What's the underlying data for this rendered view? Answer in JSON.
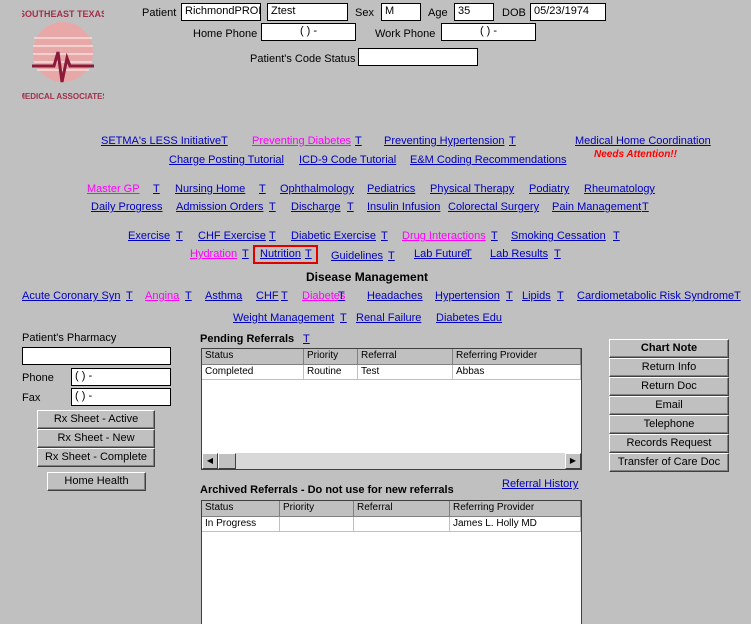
{
  "logo": {
    "text": "SOUTHEAST TEXAS SETMA MEDICAL ASSOCIATES, L.L.P."
  },
  "patient": {
    "label": "Patient",
    "last": "RichmondPROD",
    "first": "Ztest",
    "sex_label": "Sex",
    "sex": "M",
    "age_label": "Age",
    "age": "35",
    "dob_label": "DOB",
    "dob": "05/23/1974",
    "home_phone_label": "Home Phone",
    "home_phone": "(   )   -",
    "work_phone_label": "Work Phone",
    "work_phone": "(   )   -",
    "code_status_label": "Patient's Code Status",
    "code_status": ""
  },
  "links": [
    {
      "label": "SETMA's LESS Initiative",
      "pink": false
    },
    {
      "label": "T"
    },
    {
      "label": "Preventing Diabetes",
      "pink": true
    },
    {
      "label": "T"
    },
    {
      "label": "Preventing Hypertension",
      "pink": false
    },
    {
      "label": "T"
    },
    {
      "label": "Medical Home Coordination",
      "pink": false
    },
    {
      "label": "Charge Posting Tutorial"
    },
    {
      "label": "ICD-9 Code Tutorial"
    },
    {
      "label": "E&M Coding Recommendations"
    },
    {
      "label": "Master GP",
      "pink": true
    },
    {
      "label": "T"
    },
    {
      "label": "Nursing Home"
    },
    {
      "label": "T"
    },
    {
      "label": "Ophthalmology"
    },
    {
      "label": "Pediatrics"
    },
    {
      "label": "Physical Therapy"
    },
    {
      "label": "Podiatry"
    },
    {
      "label": "Rheumatology"
    },
    {
      "label": "Daily Progress"
    },
    {
      "label": "Admission Orders"
    },
    {
      "label": "T"
    },
    {
      "label": "Discharge"
    },
    {
      "label": "T"
    },
    {
      "label": "Insulin Infusion"
    },
    {
      "label": "Colorectal Surgery"
    },
    {
      "label": "Pain Management"
    },
    {
      "label": "T"
    },
    {
      "label": "Exercise"
    },
    {
      "label": "T"
    },
    {
      "label": "CHF Exercise"
    },
    {
      "label": "T"
    },
    {
      "label": "Diabetic Exercise"
    },
    {
      "label": "T"
    },
    {
      "label": "Drug Interactions",
      "pink": true
    },
    {
      "label": "T"
    },
    {
      "label": "Smoking Cessation"
    },
    {
      "label": "T"
    },
    {
      "label": "Hydration",
      "pink": true
    },
    {
      "label": "T"
    },
    {
      "label": "Nutrition"
    },
    {
      "label": "T"
    },
    {
      "label": "Guidelines"
    },
    {
      "label": "T"
    },
    {
      "label": "Lab Future"
    },
    {
      "label": "T"
    },
    {
      "label": "Lab Results"
    },
    {
      "label": "T"
    },
    {
      "label": "Acute Coronary Syn"
    },
    {
      "label": "T"
    },
    {
      "label": "Angina",
      "pink": true
    },
    {
      "label": "T"
    },
    {
      "label": "Asthma"
    },
    {
      "label": "CHF"
    },
    {
      "label": "T"
    },
    {
      "label": "Diabetes",
      "pink": true
    },
    {
      "label": "T"
    },
    {
      "label": "Headaches"
    },
    {
      "label": "Hypertension"
    },
    {
      "label": "T"
    },
    {
      "label": "Lipids"
    },
    {
      "label": "T"
    },
    {
      "label": "Cardiometabolic Risk Syndrome"
    },
    {
      "label": "T"
    },
    {
      "label": "Weight Management"
    },
    {
      "label": "T"
    },
    {
      "label": "Renal Failure"
    },
    {
      "label": "Diabetes Edu"
    }
  ],
  "needs_attention": "Needs Attention!!",
  "disease_management": "Disease Management",
  "colors": {
    "link": "#0000c0",
    "pink": "#ff00ff",
    "attention": "#ff0000",
    "highlight": "#e00000"
  },
  "pharmacy": {
    "label": "Patient's Pharmacy",
    "value": "",
    "phone_label": "Phone",
    "phone": "(   )   -",
    "fax_label": "Fax",
    "fax": "(   )   -"
  },
  "rx_buttons": [
    "Rx Sheet - Active",
    "Rx Sheet - New",
    "Rx Sheet - Complete"
  ],
  "home_health": "Home Health",
  "pending": {
    "title": "Pending Referrals",
    "t": "T",
    "columns": [
      "Status",
      "Priority",
      "Referral",
      "Referring Provider"
    ],
    "rows": [
      [
        "Completed",
        "Routine",
        "Test",
        "Abbas"
      ]
    ]
  },
  "archived": {
    "title": "Archived Referrals - Do not use for new referrals",
    "history": "Referral History",
    "columns": [
      "Status",
      "Priority",
      "Referral",
      "Referring Provider"
    ],
    "rows": [
      [
        "In Progress",
        "",
        "",
        "James L. Holly MD"
      ]
    ]
  },
  "right_buttons": [
    "Chart Note",
    "Return Info",
    "Return Doc",
    "Email",
    "Telephone",
    "Records Request",
    "Transfer of Care Doc"
  ]
}
